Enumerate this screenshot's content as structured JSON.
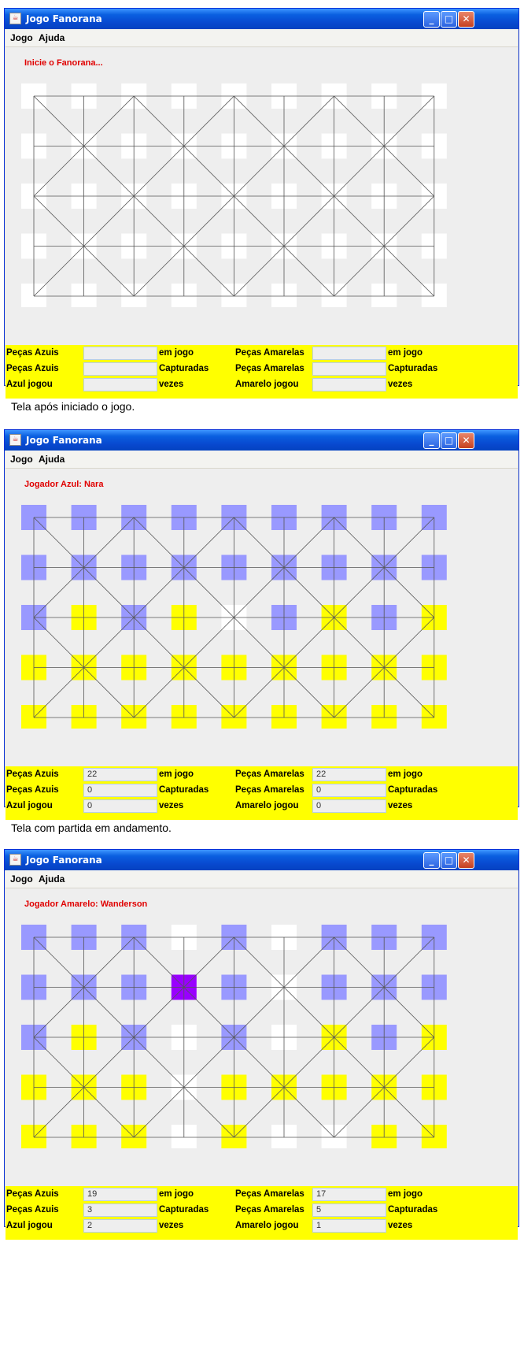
{
  "windows": [
    {
      "title": "Jogo Fanorana",
      "menu": [
        "Jogo",
        "Ajuda"
      ],
      "status": "Inicie o Fanorana...",
      "board": [
        [
          "white",
          "white",
          "white",
          "white",
          "white",
          "white",
          "white",
          "white",
          "white"
        ],
        [
          "white",
          "white",
          "white",
          "white",
          "white",
          "white",
          "white",
          "white",
          "white"
        ],
        [
          "white",
          "white",
          "white",
          "white",
          "white",
          "white",
          "white",
          "white",
          "white"
        ],
        [
          "white",
          "white",
          "white",
          "white",
          "white",
          "white",
          "white",
          "white",
          "white"
        ],
        [
          "white",
          "white",
          "white",
          "white",
          "white",
          "white",
          "white",
          "white",
          "white"
        ]
      ],
      "info": {
        "blue_label": "Peças Azuis",
        "yellow_label": "Peças Amarelas",
        "in_game_label": "em jogo",
        "captured_label": "Capturadas",
        "blue_played_label": "Azul jogou",
        "yellow_played_label": "Amarelo jogou",
        "times_label": "vezes",
        "blue_in_game": "",
        "yellow_in_game": "",
        "blue_captured": "",
        "yellow_captured": "",
        "blue_played": "",
        "yellow_played": ""
      },
      "caption": "Tela após iniciado o jogo."
    },
    {
      "title": "Jogo Fanorana",
      "menu": [
        "Jogo",
        "Ajuda"
      ],
      "status": "Jogador Azul: Nara",
      "board": [
        [
          "blue",
          "blue",
          "blue",
          "blue",
          "blue",
          "blue",
          "blue",
          "blue",
          "blue"
        ],
        [
          "blue",
          "blue",
          "blue",
          "blue",
          "blue",
          "blue",
          "blue",
          "blue",
          "blue"
        ],
        [
          "blue",
          "yellow",
          "blue",
          "yellow",
          "white",
          "blue",
          "yellow",
          "blue",
          "yellow"
        ],
        [
          "yellow",
          "yellow",
          "yellow",
          "yellow",
          "yellow",
          "yellow",
          "yellow",
          "yellow",
          "yellow"
        ],
        [
          "yellow",
          "yellow",
          "yellow",
          "yellow",
          "yellow",
          "yellow",
          "yellow",
          "yellow",
          "yellow"
        ]
      ],
      "info": {
        "blue_label": "Peças Azuis",
        "yellow_label": "Peças Amarelas",
        "in_game_label": "em jogo",
        "captured_label": "Capturadas",
        "blue_played_label": "Azul jogou",
        "yellow_played_label": "Amarelo jogou",
        "times_label": "vezes",
        "blue_in_game": "22",
        "yellow_in_game": "22",
        "blue_captured": "0",
        "yellow_captured": "0",
        "blue_played": "0",
        "yellow_played": "0"
      },
      "caption": "Tela com partida em andamento."
    },
    {
      "title": "Jogo Fanorana",
      "menu": [
        "Jogo",
        "Ajuda"
      ],
      "status": "Jogador Amarelo: Wanderson",
      "board": [
        [
          "blue",
          "blue",
          "blue",
          "white",
          "blue",
          "white",
          "blue",
          "blue",
          "blue"
        ],
        [
          "blue",
          "blue",
          "blue",
          "purple",
          "blue",
          "white",
          "blue",
          "blue",
          "blue"
        ],
        [
          "blue",
          "yellow",
          "blue",
          "white",
          "blue",
          "white",
          "yellow",
          "blue",
          "yellow"
        ],
        [
          "yellow",
          "yellow",
          "yellow",
          "white",
          "yellow",
          "yellow",
          "yellow",
          "yellow",
          "yellow"
        ],
        [
          "yellow",
          "yellow",
          "yellow",
          "white",
          "yellow",
          "white",
          "white",
          "yellow",
          "yellow"
        ]
      ],
      "info": {
        "blue_label": "Peças Azuis",
        "yellow_label": "Peças Amarelas",
        "in_game_label": "em jogo",
        "captured_label": "Capturadas",
        "blue_played_label": "Azul jogou",
        "yellow_played_label": "Amarelo jogou",
        "times_label": "vezes",
        "blue_in_game": "19",
        "yellow_in_game": "17",
        "blue_captured": "3",
        "yellow_captured": "5",
        "blue_played": "2",
        "yellow_played": "1"
      },
      "caption": ""
    }
  ],
  "colors": {
    "blue": "#9999FF",
    "yellow": "#FFFF00",
    "white": "#FFFFFF",
    "purple": "#9900FF",
    "status_text": "#E00000",
    "info_panel": "#FFFF00"
  }
}
